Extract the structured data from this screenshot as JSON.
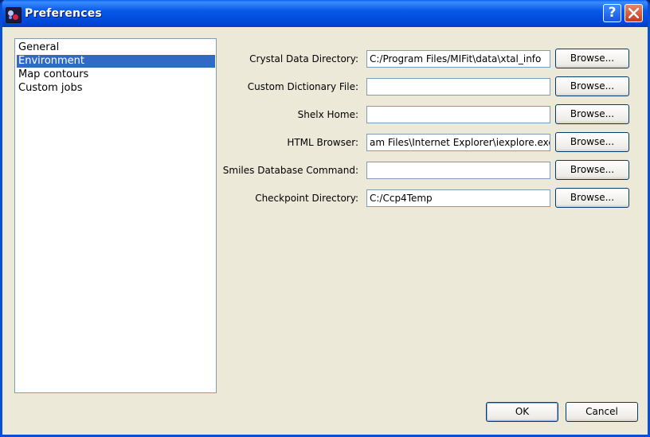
{
  "window": {
    "title": "Preferences",
    "help_label": "?"
  },
  "categories": {
    "items": [
      "General",
      "Environment",
      "Map contours",
      "Custom jobs"
    ],
    "selected": "Environment"
  },
  "environment": {
    "rows": [
      {
        "label": "Crystal Data Directory:",
        "value": "C:/Program Files/MIFit\\data\\xtal_info",
        "button": "Browse..."
      },
      {
        "label": "Custom Dictionary File:",
        "value": "",
        "button": "Browse..."
      },
      {
        "label": "Shelx Home:",
        "value": "",
        "button": "Browse..."
      },
      {
        "label": "HTML Browser:",
        "value": "am Files\\Internet Explorer\\iexplore.exe",
        "button": "Browse..."
      },
      {
        "label": "Smiles Database Command:",
        "value": "",
        "button": "Browse..."
      },
      {
        "label": "Checkpoint Directory:",
        "value": "C:/Ccp4Temp",
        "button": "Browse..."
      }
    ]
  },
  "footer": {
    "ok_label": "OK",
    "cancel_label": "Cancel"
  }
}
